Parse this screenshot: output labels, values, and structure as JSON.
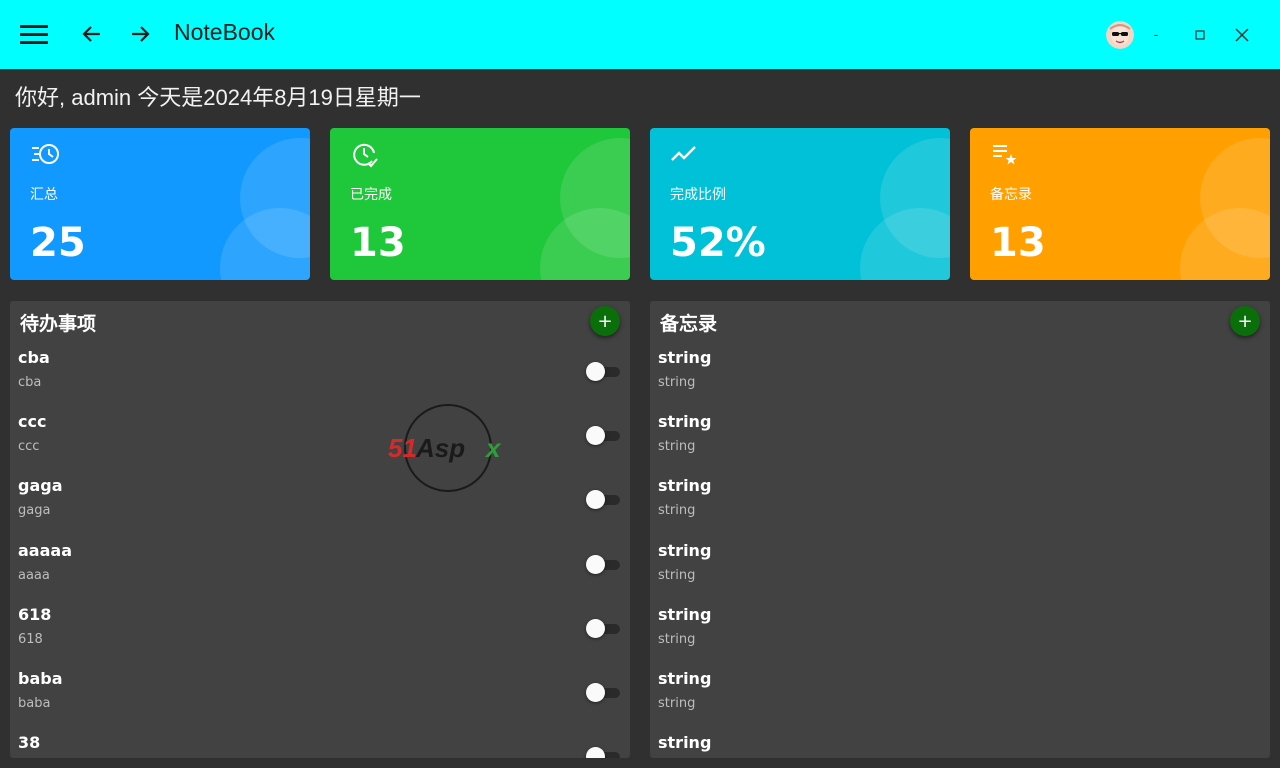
{
  "window": {
    "title": "NoteBook",
    "minimize_label": "-",
    "maximize_label": "□",
    "close_label": "✕"
  },
  "greeting": "你好, admin 今天是2024年8月19日星期一",
  "stats": [
    {
      "label": "汇总",
      "value": "25",
      "color": "#1199ff",
      "icon": "history-list-icon"
    },
    {
      "label": "已完成",
      "value": "13",
      "color": "#1fc73a",
      "icon": "clock-check-icon"
    },
    {
      "label": "完成比例",
      "value": "52%",
      "color": "#00c1d7",
      "icon": "trending-up-icon"
    },
    {
      "label": "备忘录",
      "value": "13",
      "color": "#ffa000",
      "icon": "playlist-star-icon"
    }
  ],
  "todo_panel": {
    "title": "待办事项",
    "add_label": "+",
    "items": [
      {
        "title": "cba",
        "content": "cba",
        "done": false
      },
      {
        "title": "ccc",
        "content": "ccc",
        "done": false
      },
      {
        "title": "gaga",
        "content": "gaga",
        "done": false
      },
      {
        "title": "aaaaa",
        "content": "aaaa",
        "done": false
      },
      {
        "title": "618",
        "content": "618",
        "done": false
      },
      {
        "title": "baba",
        "content": "baba",
        "done": false
      },
      {
        "title": "38",
        "content": "",
        "done": false
      }
    ]
  },
  "memo_panel": {
    "title": "备忘录",
    "add_label": "+",
    "items": [
      {
        "title": "string",
        "content": "string"
      },
      {
        "title": "string",
        "content": "string"
      },
      {
        "title": "string",
        "content": "string"
      },
      {
        "title": "string",
        "content": "string"
      },
      {
        "title": "string",
        "content": "string"
      },
      {
        "title": "string",
        "content": "string"
      },
      {
        "title": "string",
        "content": ""
      }
    ]
  },
  "watermark": {
    "text": "51Aspx"
  }
}
